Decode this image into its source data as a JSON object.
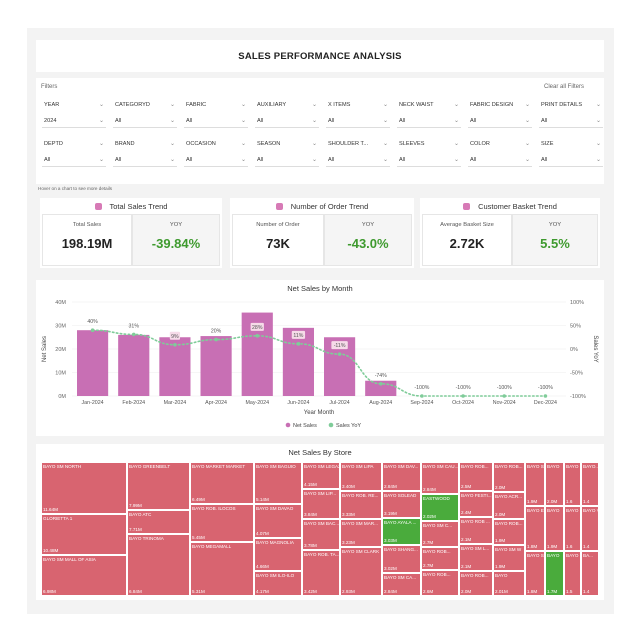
{
  "title": "SALES PERFORMANCE ANALYSIS",
  "filters": {
    "label": "Filters",
    "clear": "Clear all Filters",
    "row1": [
      {
        "label": "YEAR",
        "value": "2024"
      },
      {
        "label": "CATEGORYD",
        "value": "All"
      },
      {
        "label": "FABRIC",
        "value": "All"
      },
      {
        "label": "AUXILIARY",
        "value": "All"
      },
      {
        "label": "X ITEMS",
        "value": "All"
      },
      {
        "label": "NECK WAIST",
        "value": "All"
      },
      {
        "label": "FABRIC DESIGN",
        "value": "All"
      },
      {
        "label": "PRINT DETAILS",
        "value": "All"
      }
    ],
    "row2": [
      {
        "label": "DEPTD",
        "value": "All"
      },
      {
        "label": "BRAND",
        "value": "All"
      },
      {
        "label": "OCCASION",
        "value": "All"
      },
      {
        "label": "SEASON",
        "value": "All"
      },
      {
        "label": "SHOULDER T...",
        "value": "All"
      },
      {
        "label": "SLEEVES",
        "value": "All"
      },
      {
        "label": "COLOR",
        "value": "All"
      },
      {
        "label": "SIZE",
        "value": "All"
      }
    ]
  },
  "hover_note": "Hover on a chart to see more details",
  "kpis": [
    {
      "title": "Total Sales Trend",
      "label": "Total Sales",
      "value": "198.19M",
      "yoy_label": "YOY",
      "yoy": "-39.84%"
    },
    {
      "title": "Number of Order Trend",
      "label": "Number of Order",
      "value": "73K",
      "yoy_label": "YOY",
      "yoy": "-43.0%"
    },
    {
      "title": "Customer Basket Trend",
      "label": "Average Basket Size",
      "value": "2.72K",
      "yoy_label": "YOY",
      "yoy": "5.5%"
    }
  ],
  "chart_data": {
    "type": "bar",
    "title": "Net Sales by Month",
    "xlabel": "Year Month",
    "ylabel": "Net Sales",
    "y2label": "Sales YoY",
    "categories": [
      "Jan-2024",
      "Feb-2024",
      "Mar-2024",
      "Apr-2024",
      "May-2024",
      "Jun-2024",
      "Jul-2024",
      "Aug-2024",
      "Sep-2024",
      "Oct-2024",
      "Nov-2024",
      "Dec-2024"
    ],
    "ylim": [
      0,
      40000000
    ],
    "yticks": [
      "0M",
      "10M",
      "20M",
      "30M",
      "40M"
    ],
    "y2lim": [
      -100,
      100
    ],
    "y2ticks": [
      "100%",
      "50%",
      "0%",
      "-50%",
      "-100%"
    ],
    "series": [
      {
        "name": "Net Sales",
        "type": "bar",
        "color": "#c86fb4",
        "values": [
          28000000,
          26000000,
          25000000,
          25500000,
          35500000,
          29000000,
          25000000,
          6500000,
          0,
          0,
          0,
          0
        ]
      },
      {
        "name": "Sales YoY",
        "type": "line",
        "color": "#7fcc99",
        "values": [
          40,
          31,
          9,
          20,
          28,
          11,
          -11,
          -74,
          -100,
          -100,
          -100,
          -100
        ],
        "labels": [
          "40%",
          "31%",
          "9%",
          "20%",
          "28%",
          "11%",
          "-11%",
          "-74%",
          "-100%",
          "-100%",
          "-100%",
          "-100%"
        ]
      }
    ],
    "legend": "bottom"
  },
  "treemap": {
    "title": "Net Sales By Store",
    "tiles": [
      {
        "name": "BAYO SM NORTH",
        "value": "11.64M",
        "color": "red"
      },
      {
        "name": "GLORIETTA 1",
        "value": "10.48M",
        "color": "red"
      },
      {
        "name": "BAYO SM MALL OF ASIA",
        "value": "6.98M",
        "color": "red"
      },
      {
        "name": "BAYO GREENBELT",
        "value": "7.99M",
        "color": "red"
      },
      {
        "name": "BAYO ATC",
        "value": "7.71M",
        "color": "red"
      },
      {
        "name": "BAYO TRINOMA",
        "value": "6.84M",
        "color": "red"
      },
      {
        "name": "BAYO MARKET MARKET",
        "value": "6.49M",
        "color": "red"
      },
      {
        "name": "BAYO ROB. ILOCOS",
        "value": "5.45M",
        "color": "red"
      },
      {
        "name": "BAYO MEGAMALL",
        "value": "5.31M",
        "color": "red"
      },
      {
        "name": "BAYO SM BAGUIO",
        "value": "5.14M",
        "color": "red"
      },
      {
        "name": "BAYO SM DAVAO",
        "value": "4.07M",
        "color": "red"
      },
      {
        "name": "BAYO MAGNOLIA",
        "value": "4.66M",
        "color": "red"
      },
      {
        "name": "BAYO SM ILO-ILO",
        "value": "4.17M",
        "color": "red"
      },
      {
        "name": "BAYO SM LEGAZPI",
        "value": "4.15M",
        "color": "red"
      },
      {
        "name": "BAYO SM LIP...",
        "value": "3.84M",
        "color": "red"
      },
      {
        "name": "BAYO SM BAC...",
        "value": "3.78M",
        "color": "red"
      },
      {
        "name": "BAYO ROB. TA...",
        "value": "3.42M",
        "color": "red"
      },
      {
        "name": "BAYO SM LIPA",
        "value": "3.40M",
        "color": "red"
      },
      {
        "name": "BAYO ROB. RE...",
        "value": "3.33M",
        "color": "red"
      },
      {
        "name": "BAYO SM MAR...",
        "value": "3.23M",
        "color": "red"
      },
      {
        "name": "BAYO SM CLARK",
        "value": "2.93M",
        "color": "red"
      },
      {
        "name": "BAYO SM DAV...",
        "value": "2.84M",
        "color": "red"
      },
      {
        "name": "BAYO SOLEAD",
        "value": "3.19M",
        "color": "red"
      },
      {
        "name": "BAYO AYALA ...",
        "value": "3.03M",
        "color": "green"
      },
      {
        "name": "BAYO SHANG...",
        "value": "3.02M",
        "color": "red"
      },
      {
        "name": "BAYO SM CA...",
        "value": "2.84M",
        "color": "red"
      },
      {
        "name": "BAYO SM CAU...",
        "value": "2.84M",
        "color": "red"
      },
      {
        "name": "EASTWOOD",
        "value": "2.02M",
        "color": "green"
      },
      {
        "name": "BAYO SM C...",
        "value": "2.7M",
        "color": "red"
      },
      {
        "name": "BAYO ROB...",
        "value": "2.7M",
        "color": "red"
      },
      {
        "name": "BAYO ROB...",
        "value": "2.6M",
        "color": "red"
      },
      {
        "name": "BAYO ROB...",
        "value": "2.5M",
        "color": "red"
      },
      {
        "name": "BAYO FESTI...",
        "value": "2.4M",
        "color": "red"
      },
      {
        "name": "BAYO ROB ...",
        "value": "2.1M",
        "color": "red"
      },
      {
        "name": "BAYO SM L...",
        "value": "2.1M",
        "color": "red"
      },
      {
        "name": "BAYO ROB...",
        "value": "2.0M",
        "color": "red"
      },
      {
        "name": "BAYO ROB...",
        "value": "2.0M",
        "color": "red"
      },
      {
        "name": "BAYO ACR...",
        "value": "2.0M",
        "color": "red"
      },
      {
        "name": "BAYO ROB...",
        "value": "1.9M",
        "color": "red"
      },
      {
        "name": "BAYO SM W",
        "value": "1.9M",
        "color": "red"
      },
      {
        "name": "BAYO",
        "value": "2.01M",
        "color": "red"
      },
      {
        "name": "BAYO SM...",
        "value": "1.9M",
        "color": "red"
      },
      {
        "name": "BAYO EVI...",
        "value": "1.8M",
        "color": "red"
      },
      {
        "name": "BAYO SM...",
        "value": "1.8M",
        "color": "red"
      },
      {
        "name": "BAYO",
        "value": "2.0M",
        "color": "red"
      },
      {
        "name": "BAYO",
        "value": "1.9M",
        "color": "red"
      },
      {
        "name": "BAYO",
        "value": "1.7M",
        "color": "green"
      },
      {
        "name": "BAYO",
        "value": "1.6",
        "color": "red"
      },
      {
        "name": "BAYO S...",
        "value": "1.6",
        "color": "red"
      },
      {
        "name": "BAYO SM...",
        "value": "1.5",
        "color": "red"
      },
      {
        "name": "BAYO...",
        "value": "1.4",
        "color": "red"
      },
      {
        "name": "BAYO V...",
        "value": "1.4",
        "color": "red"
      },
      {
        "name": "BA...",
        "value": "1.4",
        "color": "red"
      },
      {
        "name": "BAYO",
        "value": "1.4",
        "color": "red"
      },
      {
        "name": "BAYO",
        "value": "1.3",
        "color": "red"
      },
      {
        "name": "BA...",
        "value": "1.3",
        "color": "red"
      }
    ]
  },
  "colors": {
    "bar": "#c86fb4",
    "yoy_line": "#7fcc99",
    "positive": "#3e9a2e",
    "tile_red": "#d86470",
    "tile_green": "#4aab3c"
  }
}
